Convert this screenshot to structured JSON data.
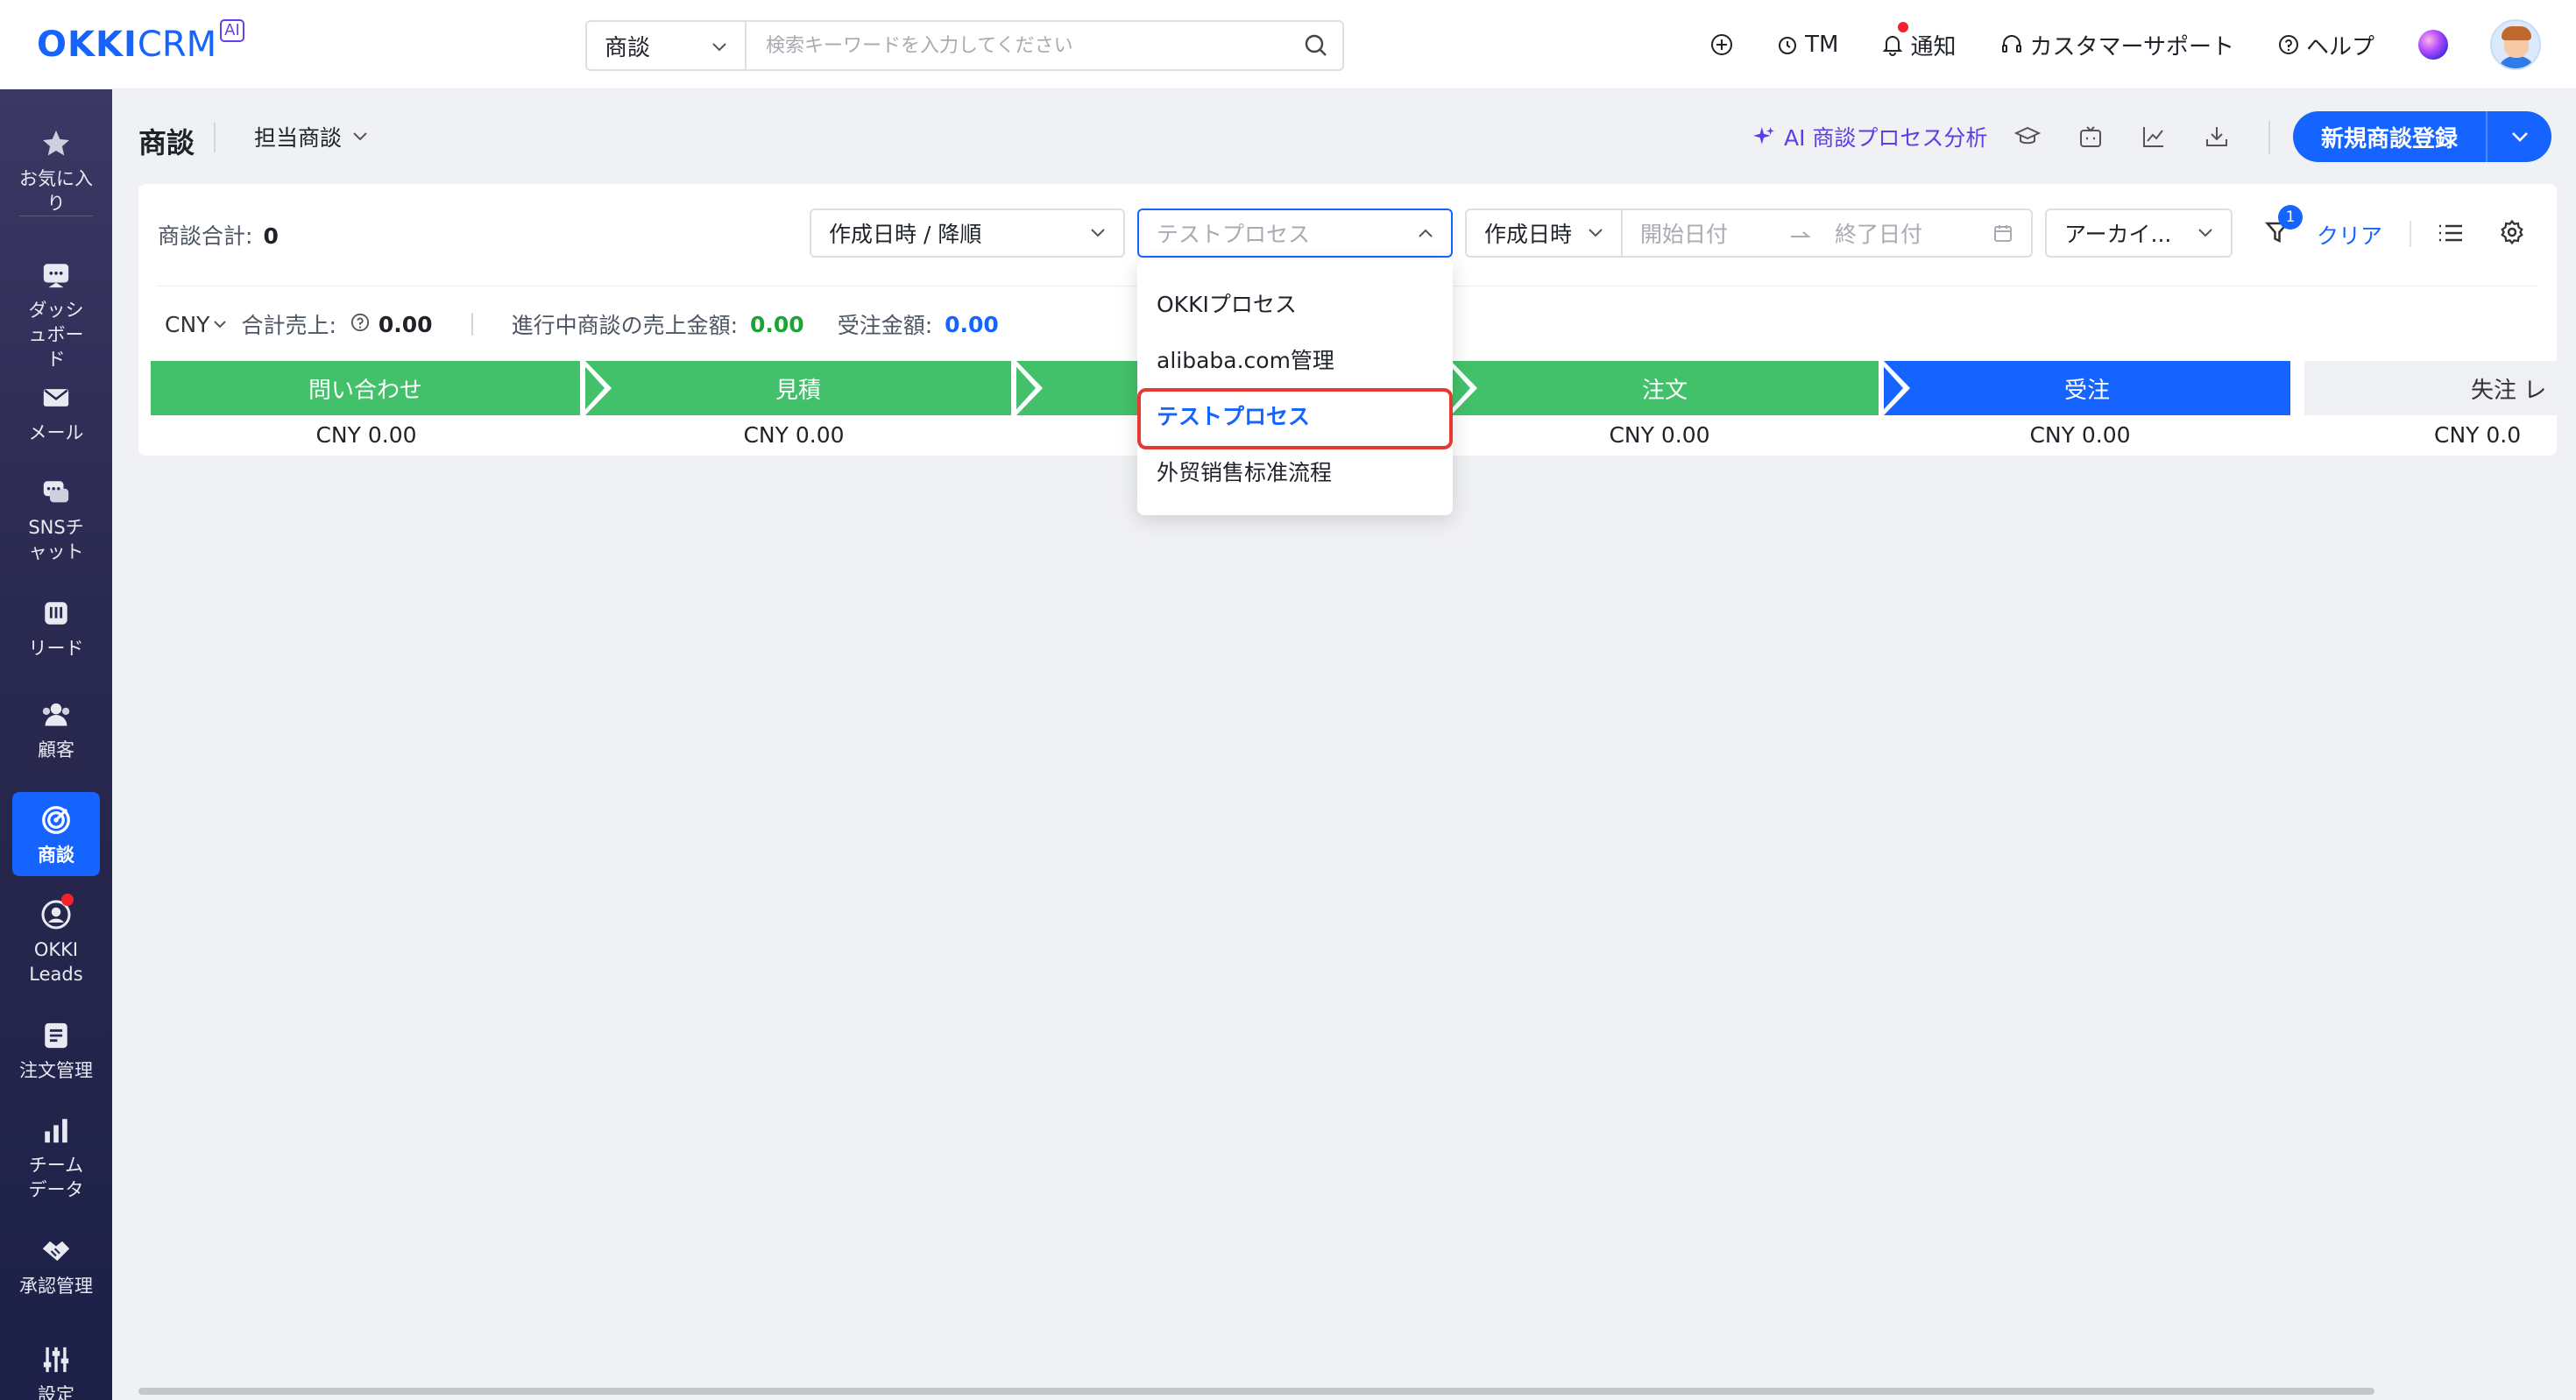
{
  "app": {
    "logo_okki": "OKKI",
    "logo_crm": "CRM",
    "logo_ai": "AI"
  },
  "search": {
    "scope": "商談",
    "placeholder": "検索キーワードを入力してください"
  },
  "topnav": {
    "tm": "TM",
    "notify": "通知",
    "support": "カスタマーサポート",
    "help": "ヘルプ"
  },
  "sidebar": {
    "items": [
      {
        "label": "お気に入り",
        "icon": "star-icon"
      },
      {
        "label": "ダッシュボード",
        "icon": "dashboard-icon"
      },
      {
        "label": "メール",
        "icon": "mail-icon"
      },
      {
        "label": "SNSチャット",
        "icon": "chat-icon"
      },
      {
        "label": "リード",
        "icon": "lead-icon"
      },
      {
        "label": "顧客",
        "icon": "customer-icon"
      },
      {
        "label": "商談",
        "icon": "target-icon",
        "active": true
      },
      {
        "label": "OKKI Leads",
        "icon": "okki-leads-icon"
      },
      {
        "label": "注文管理",
        "icon": "order-icon"
      },
      {
        "label": "チームデータ",
        "icon": "bar-chart-icon"
      },
      {
        "label": "承認管理",
        "icon": "handshake-icon"
      },
      {
        "label": "設定",
        "icon": "settings-sliders-icon"
      }
    ]
  },
  "header": {
    "title": "商談",
    "view": "担当商談",
    "ai_analysis": "AI 商談プロセス分析",
    "new_button": "新規商談登録"
  },
  "toolbar": {
    "total_label": "商談合計:",
    "total_value": "0",
    "sort": "作成日時 / 降順",
    "process_placeholder": "テストプロセス",
    "date_field": "作成日時",
    "start_placeholder": "開始日付",
    "end_placeholder": "終了日付",
    "archive": "アーカイ...",
    "filter_count": "1",
    "clear": "クリア"
  },
  "summary": {
    "currency": "CNY",
    "total_sales_label": "合計売上:",
    "total_sales": "0.00",
    "in_progress_label": "進行中商談の売上金額:",
    "in_progress": "0.00",
    "won_label": "受注金額:",
    "won": "0.00"
  },
  "stages": [
    {
      "name": "問い合わせ",
      "amount": "CNY 0.00"
    },
    {
      "name": "見積",
      "amount": "CNY 0.00"
    },
    {
      "name": "",
      "amount": ""
    },
    {
      "name": "注文",
      "amount": "CNY 0.00"
    },
    {
      "name": "受注",
      "amount": "CNY 0.00"
    },
    {
      "name": "失注 レ",
      "amount": "CNY 0.0"
    }
  ],
  "dropdown": {
    "options": [
      "OKKIプロセス",
      "alibaba.com管理",
      "テストプロセス",
      "外贸销售标准流程"
    ],
    "selected": "テストプロセス"
  },
  "colors": {
    "accent": "#1664ff",
    "stage_green": "#43c16a",
    "sidebar_bg": "#2a2950",
    "highlight": "#e53935"
  }
}
